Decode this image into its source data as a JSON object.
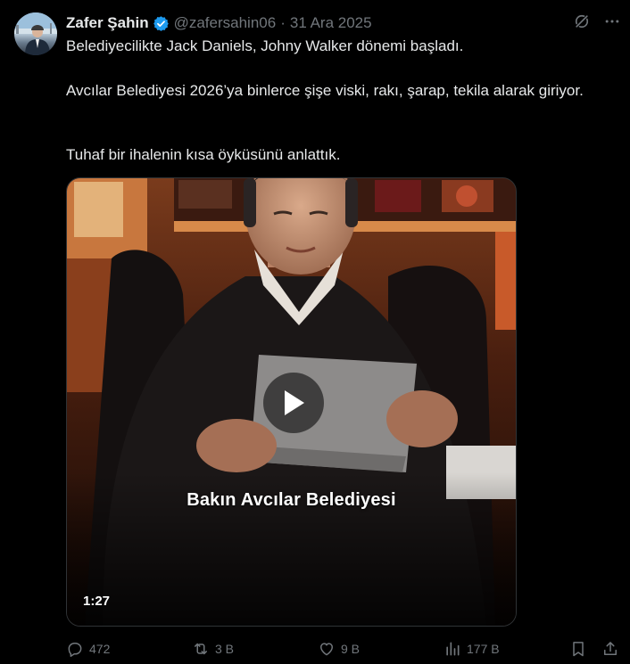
{
  "author": {
    "name": "Zafer Şahin",
    "handle": "@zafersahin06",
    "date": "31 Ara 2025"
  },
  "tweet": {
    "paragraphs": [
      "Belediyecilikte Jack Daniels, Johny Walker dönemi başladı.",
      "Avcılar Belediyesi 2026’ya binlerce şişe viski, rakı, şarap, tekila alarak giriyor.",
      "Tuhaf bir ihalenin kısa öyküsünü anlattık."
    ]
  },
  "video": {
    "caption": "Bakın Avcılar Belediyesi",
    "duration": "1:27"
  },
  "metrics": {
    "replies": "472",
    "reposts": "3 B",
    "likes": "9 B",
    "views": "177 B"
  },
  "icons": {
    "verified": "verified-badge-icon",
    "grok": "grok-icon",
    "more": "more-icon",
    "reply": "reply-icon",
    "repost": "repost-icon",
    "like": "like-icon",
    "views": "views-icon",
    "bookmark": "bookmark-icon",
    "share": "share-icon",
    "play": "play-icon"
  },
  "colors": {
    "background": "#000000",
    "text": "#e7e9ea",
    "secondary": "#71767b",
    "verified": "#1d9bf0"
  }
}
